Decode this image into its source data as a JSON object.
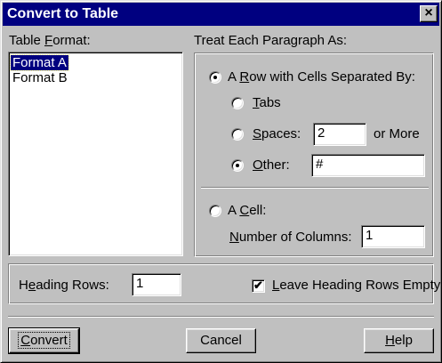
{
  "window": {
    "title": "Convert to Table",
    "close_glyph": "×"
  },
  "table_format": {
    "label_pre": "Table ",
    "label_key": "F",
    "label_post": "ormat:",
    "items": [
      "Format A",
      "Format B"
    ],
    "selected": "Format A"
  },
  "treat": {
    "label": "Treat Each Paragraph As:",
    "row_option": {
      "pre": "A ",
      "key": "R",
      "post": "ow with Cells Separated By:",
      "selected": true
    },
    "tabs": {
      "key": "T",
      "post": "abs",
      "selected": false
    },
    "spaces": {
      "key": "S",
      "post": "paces:",
      "value": "2",
      "suffix": "or More",
      "selected": false
    },
    "other": {
      "key": "O",
      "post": "ther:",
      "value": "#",
      "selected": true
    },
    "cell_option": {
      "pre": "A ",
      "key": "C",
      "post": "ell:",
      "selected": false
    },
    "columns": {
      "key": "N",
      "post": "umber of Columns:",
      "value": "1"
    }
  },
  "heading": {
    "label_pre": "H",
    "label_key": "e",
    "label_post": "ading Rows:",
    "value": "1",
    "leave_empty": {
      "key": "L",
      "post": "eave Heading Rows Empty",
      "checked": true,
      "mark": "✔"
    }
  },
  "buttons": {
    "convert": {
      "key": "C",
      "post": "onvert"
    },
    "cancel": "Cancel",
    "help": {
      "key": "H",
      "post": "elp"
    }
  }
}
